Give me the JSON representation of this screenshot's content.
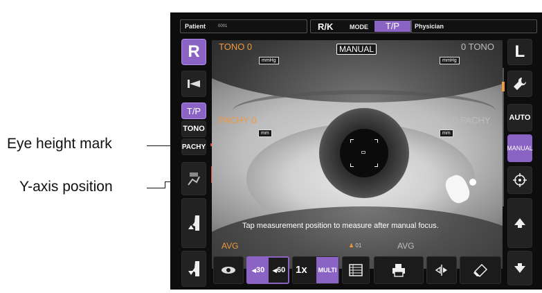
{
  "callouts": {
    "eye_height_mark": "Eye height mark",
    "y_axis_position": "Y-axis position"
  },
  "topbar": {
    "patient_label": "Patient",
    "patient_value": "0001",
    "rk_label": "R/K",
    "mode_label": "MODE",
    "mode_value": "T/P",
    "physician_label": "Physician"
  },
  "left_panel": {
    "eye_side": "R",
    "mode_tp": "T/P",
    "mode_tono": "TONO",
    "mode_pachy": "PACHY"
  },
  "right_panel": {
    "eye_side": "L",
    "auto_label": "AUTO",
    "manual_label": "MANUAL"
  },
  "overlay": {
    "tono_left": "TONO 0",
    "tono_right": "0 TONO",
    "mmhg_left": "mmHg",
    "mmhg_right": "mmHg",
    "manual_badge": "MANUAL",
    "pachy_left": "PACHY 0",
    "pachy_right": "0 PACHY",
    "mm_left": "mm",
    "mm_right": "mm",
    "instruction": "Tap measurement position to measure after manual focus.",
    "avg_left": "AVG",
    "avg_right": "AVG",
    "counter": "01"
  },
  "bottombar": {
    "angle_30": "30",
    "angle_60": "60",
    "count_1x": "1x",
    "multi": "MULTI"
  },
  "colors": {
    "accent_purple": "#8a63c4",
    "orange": "#f09a3e",
    "mark_red": "#e14b3a"
  }
}
